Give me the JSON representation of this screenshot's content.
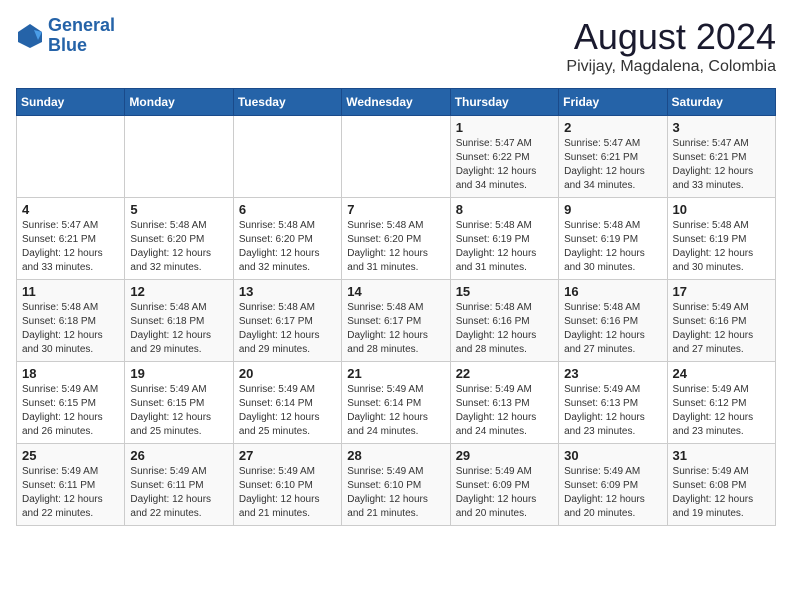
{
  "header": {
    "logo_line1": "General",
    "logo_line2": "Blue",
    "month_year": "August 2024",
    "location": "Pivijay, Magdalena, Colombia"
  },
  "days_of_week": [
    "Sunday",
    "Monday",
    "Tuesday",
    "Wednesday",
    "Thursday",
    "Friday",
    "Saturday"
  ],
  "weeks": [
    [
      {
        "day": "",
        "info": ""
      },
      {
        "day": "",
        "info": ""
      },
      {
        "day": "",
        "info": ""
      },
      {
        "day": "",
        "info": ""
      },
      {
        "day": "1",
        "info": "Sunrise: 5:47 AM\nSunset: 6:22 PM\nDaylight: 12 hours\nand 34 minutes."
      },
      {
        "day": "2",
        "info": "Sunrise: 5:47 AM\nSunset: 6:21 PM\nDaylight: 12 hours\nand 34 minutes."
      },
      {
        "day": "3",
        "info": "Sunrise: 5:47 AM\nSunset: 6:21 PM\nDaylight: 12 hours\nand 33 minutes."
      }
    ],
    [
      {
        "day": "4",
        "info": "Sunrise: 5:47 AM\nSunset: 6:21 PM\nDaylight: 12 hours\nand 33 minutes."
      },
      {
        "day": "5",
        "info": "Sunrise: 5:48 AM\nSunset: 6:20 PM\nDaylight: 12 hours\nand 32 minutes."
      },
      {
        "day": "6",
        "info": "Sunrise: 5:48 AM\nSunset: 6:20 PM\nDaylight: 12 hours\nand 32 minutes."
      },
      {
        "day": "7",
        "info": "Sunrise: 5:48 AM\nSunset: 6:20 PM\nDaylight: 12 hours\nand 31 minutes."
      },
      {
        "day": "8",
        "info": "Sunrise: 5:48 AM\nSunset: 6:19 PM\nDaylight: 12 hours\nand 31 minutes."
      },
      {
        "day": "9",
        "info": "Sunrise: 5:48 AM\nSunset: 6:19 PM\nDaylight: 12 hours\nand 30 minutes."
      },
      {
        "day": "10",
        "info": "Sunrise: 5:48 AM\nSunset: 6:19 PM\nDaylight: 12 hours\nand 30 minutes."
      }
    ],
    [
      {
        "day": "11",
        "info": "Sunrise: 5:48 AM\nSunset: 6:18 PM\nDaylight: 12 hours\nand 30 minutes."
      },
      {
        "day": "12",
        "info": "Sunrise: 5:48 AM\nSunset: 6:18 PM\nDaylight: 12 hours\nand 29 minutes."
      },
      {
        "day": "13",
        "info": "Sunrise: 5:48 AM\nSunset: 6:17 PM\nDaylight: 12 hours\nand 29 minutes."
      },
      {
        "day": "14",
        "info": "Sunrise: 5:48 AM\nSunset: 6:17 PM\nDaylight: 12 hours\nand 28 minutes."
      },
      {
        "day": "15",
        "info": "Sunrise: 5:48 AM\nSunset: 6:16 PM\nDaylight: 12 hours\nand 28 minutes."
      },
      {
        "day": "16",
        "info": "Sunrise: 5:48 AM\nSunset: 6:16 PM\nDaylight: 12 hours\nand 27 minutes."
      },
      {
        "day": "17",
        "info": "Sunrise: 5:49 AM\nSunset: 6:16 PM\nDaylight: 12 hours\nand 27 minutes."
      }
    ],
    [
      {
        "day": "18",
        "info": "Sunrise: 5:49 AM\nSunset: 6:15 PM\nDaylight: 12 hours\nand 26 minutes."
      },
      {
        "day": "19",
        "info": "Sunrise: 5:49 AM\nSunset: 6:15 PM\nDaylight: 12 hours\nand 25 minutes."
      },
      {
        "day": "20",
        "info": "Sunrise: 5:49 AM\nSunset: 6:14 PM\nDaylight: 12 hours\nand 25 minutes."
      },
      {
        "day": "21",
        "info": "Sunrise: 5:49 AM\nSunset: 6:14 PM\nDaylight: 12 hours\nand 24 minutes."
      },
      {
        "day": "22",
        "info": "Sunrise: 5:49 AM\nSunset: 6:13 PM\nDaylight: 12 hours\nand 24 minutes."
      },
      {
        "day": "23",
        "info": "Sunrise: 5:49 AM\nSunset: 6:13 PM\nDaylight: 12 hours\nand 23 minutes."
      },
      {
        "day": "24",
        "info": "Sunrise: 5:49 AM\nSunset: 6:12 PM\nDaylight: 12 hours\nand 23 minutes."
      }
    ],
    [
      {
        "day": "25",
        "info": "Sunrise: 5:49 AM\nSunset: 6:11 PM\nDaylight: 12 hours\nand 22 minutes."
      },
      {
        "day": "26",
        "info": "Sunrise: 5:49 AM\nSunset: 6:11 PM\nDaylight: 12 hours\nand 22 minutes."
      },
      {
        "day": "27",
        "info": "Sunrise: 5:49 AM\nSunset: 6:10 PM\nDaylight: 12 hours\nand 21 minutes."
      },
      {
        "day": "28",
        "info": "Sunrise: 5:49 AM\nSunset: 6:10 PM\nDaylight: 12 hours\nand 21 minutes."
      },
      {
        "day": "29",
        "info": "Sunrise: 5:49 AM\nSunset: 6:09 PM\nDaylight: 12 hours\nand 20 minutes."
      },
      {
        "day": "30",
        "info": "Sunrise: 5:49 AM\nSunset: 6:09 PM\nDaylight: 12 hours\nand 20 minutes."
      },
      {
        "day": "31",
        "info": "Sunrise: 5:49 AM\nSunset: 6:08 PM\nDaylight: 12 hours\nand 19 minutes."
      }
    ]
  ]
}
